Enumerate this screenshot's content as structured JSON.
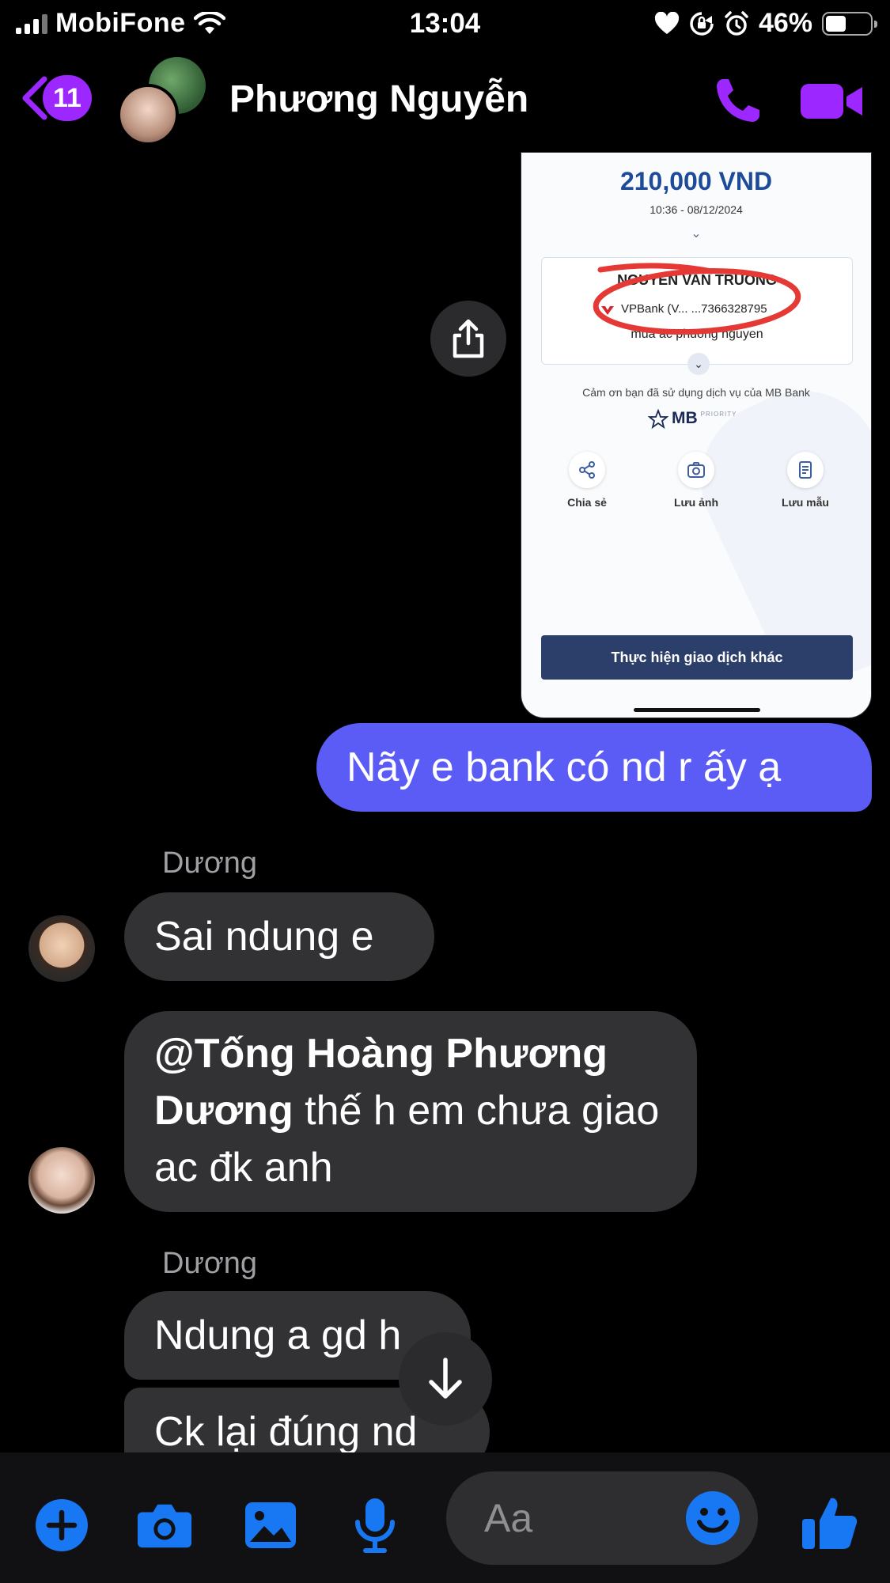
{
  "status_bar": {
    "carrier": "MobiFone",
    "time": "13:04",
    "battery_percent": "46%",
    "battery_level": 0.46
  },
  "header": {
    "back_badge": "11",
    "contact_name": "Phương Nguyễn",
    "call_icon": "phone-icon",
    "video_icon": "video-camera-icon"
  },
  "shared_image": {
    "amount": "210,000 VND",
    "datetime": "10:36 - 08/12/2024",
    "recipient": "NGUYEN VAN TRUONG",
    "bank_account": "VPBank (V... ...7366328795",
    "memo": "mua ac phuong nguyen",
    "thanks": "Cảm ơn bạn đã sử dụng dịch vụ của MB Bank",
    "logo_text": "MB",
    "logo_sub": "PRIORITY",
    "actions": [
      "Chia sẻ",
      "Lưu ảnh",
      "Lưu mẫu"
    ],
    "cta": "Thực hiện giao dịch khác"
  },
  "messages": {
    "outgoing_1": "Nãy e bank có nd r ấy ạ",
    "sender_1": "Dương",
    "incoming_1": "Sai ndung e",
    "incoming_2_mention": "@Tống Hoàng Phương Dương",
    "incoming_2_rest": " thế h em chưa giao ac đk anh",
    "sender_2": "Dương",
    "incoming_3": "Ndung a gd h",
    "incoming_4": "Ck lại đúng nd"
  },
  "composer": {
    "placeholder": "Aa"
  },
  "colors": {
    "accent": "#9c27ff",
    "outgoing_bubble": "#5b5cf6",
    "incoming_bubble": "#323234",
    "composer_icons": "#1877f2"
  }
}
